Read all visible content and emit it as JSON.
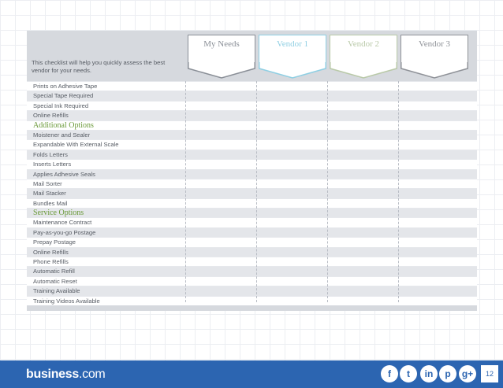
{
  "header": {
    "tabs": [
      {
        "label": "My Needs",
        "color": "#8a8f97"
      },
      {
        "label": "Vendor 1",
        "color": "#8fcfe3"
      },
      {
        "label": "Vendor 2",
        "color": "#b9c9a8"
      },
      {
        "label": "Vendor 3",
        "color": "#8f9298"
      }
    ]
  },
  "intro_text": "This checklist will help you quickly assess the best vendor for your needs.",
  "rows": [
    {
      "label": "Prints on Adhesive Tape",
      "type": "item"
    },
    {
      "label": "Special Tape Required",
      "type": "item"
    },
    {
      "label": "Special Ink Required",
      "type": "item"
    },
    {
      "label": "Online Refills",
      "type": "item"
    },
    {
      "label": "Additional Options",
      "type": "section"
    },
    {
      "label": "Moistener and Sealer",
      "type": "item"
    },
    {
      "label": "Expandable With External Scale",
      "type": "item"
    },
    {
      "label": "Folds Letters",
      "type": "item"
    },
    {
      "label": "Inserts Letters",
      "type": "item"
    },
    {
      "label": "Applies Adhesive Seals",
      "type": "item"
    },
    {
      "label": "Mail Sorter",
      "type": "item"
    },
    {
      "label": "Mail Stacker",
      "type": "item"
    },
    {
      "label": "Bundles Mail",
      "type": "item"
    },
    {
      "label": "Service Options",
      "type": "section"
    },
    {
      "label": "Maintenance Contract",
      "type": "item"
    },
    {
      "label": "Pay-as-you-go Postage",
      "type": "item"
    },
    {
      "label": "Prepay Postage",
      "type": "item"
    },
    {
      "label": "Online Refills",
      "type": "item"
    },
    {
      "label": "Phone Refills",
      "type": "item"
    },
    {
      "label": "Automatic Refill",
      "type": "item"
    },
    {
      "label": "Automatic Reset",
      "type": "item"
    },
    {
      "label": "Training Available",
      "type": "item"
    },
    {
      "label": "Training Videos Available",
      "type": "item"
    }
  ],
  "footer": {
    "brand_name": "business",
    "brand_tld": ".com",
    "social_icons": [
      "facebook-icon",
      "twitter-icon",
      "linkedin-icon",
      "pinterest-icon",
      "google-plus-icon"
    ],
    "page_number": "12",
    "background_color": "#2c65b1"
  }
}
